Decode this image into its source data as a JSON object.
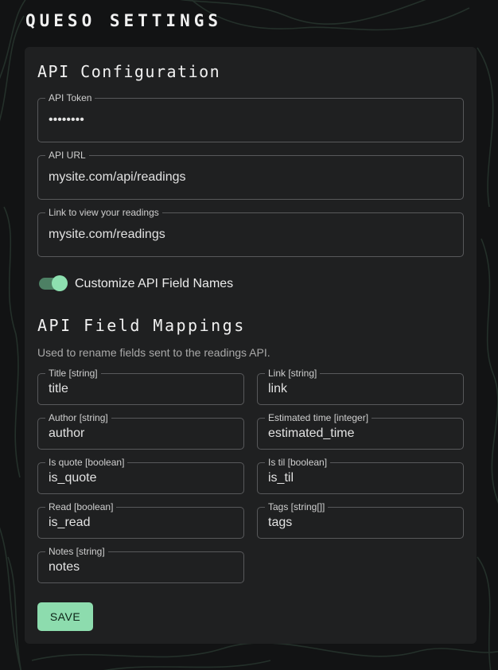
{
  "page": {
    "title": "QUESO SETTINGS"
  },
  "api_configuration": {
    "heading": "API Configuration",
    "fields": [
      {
        "label": "API Token",
        "value": "••••••••"
      },
      {
        "label": "API URL",
        "value": "mysite.com/api/readings"
      },
      {
        "label": "Link to view your readings",
        "value": "mysite.com/readings"
      }
    ],
    "customize_toggle": {
      "label": "Customize API Field Names",
      "checked": true
    }
  },
  "field_mappings": {
    "heading": "API Field Mappings",
    "description": "Used to rename fields sent to the readings API.",
    "fields": [
      {
        "label": "Title [string]",
        "value": "title"
      },
      {
        "label": "Link [string]",
        "value": "link"
      },
      {
        "label": "Author [string]",
        "value": "author"
      },
      {
        "label": "Estimated time [integer]",
        "value": "estimated_time"
      },
      {
        "label": "Is quote [boolean]",
        "value": "is_quote"
      },
      {
        "label": "Is til [boolean]",
        "value": "is_til"
      },
      {
        "label": "Read [boolean]",
        "value": "is_read"
      },
      {
        "label": "Tags [string[]]",
        "value": "tags"
      },
      {
        "label": "Notes [string]",
        "value": "notes"
      }
    ]
  },
  "actions": {
    "save_label": "SAVE"
  },
  "colors": {
    "background": "#121314",
    "panel": "#1f2021",
    "accent": "#8ddcae",
    "toggle_track": "#4d8064"
  }
}
